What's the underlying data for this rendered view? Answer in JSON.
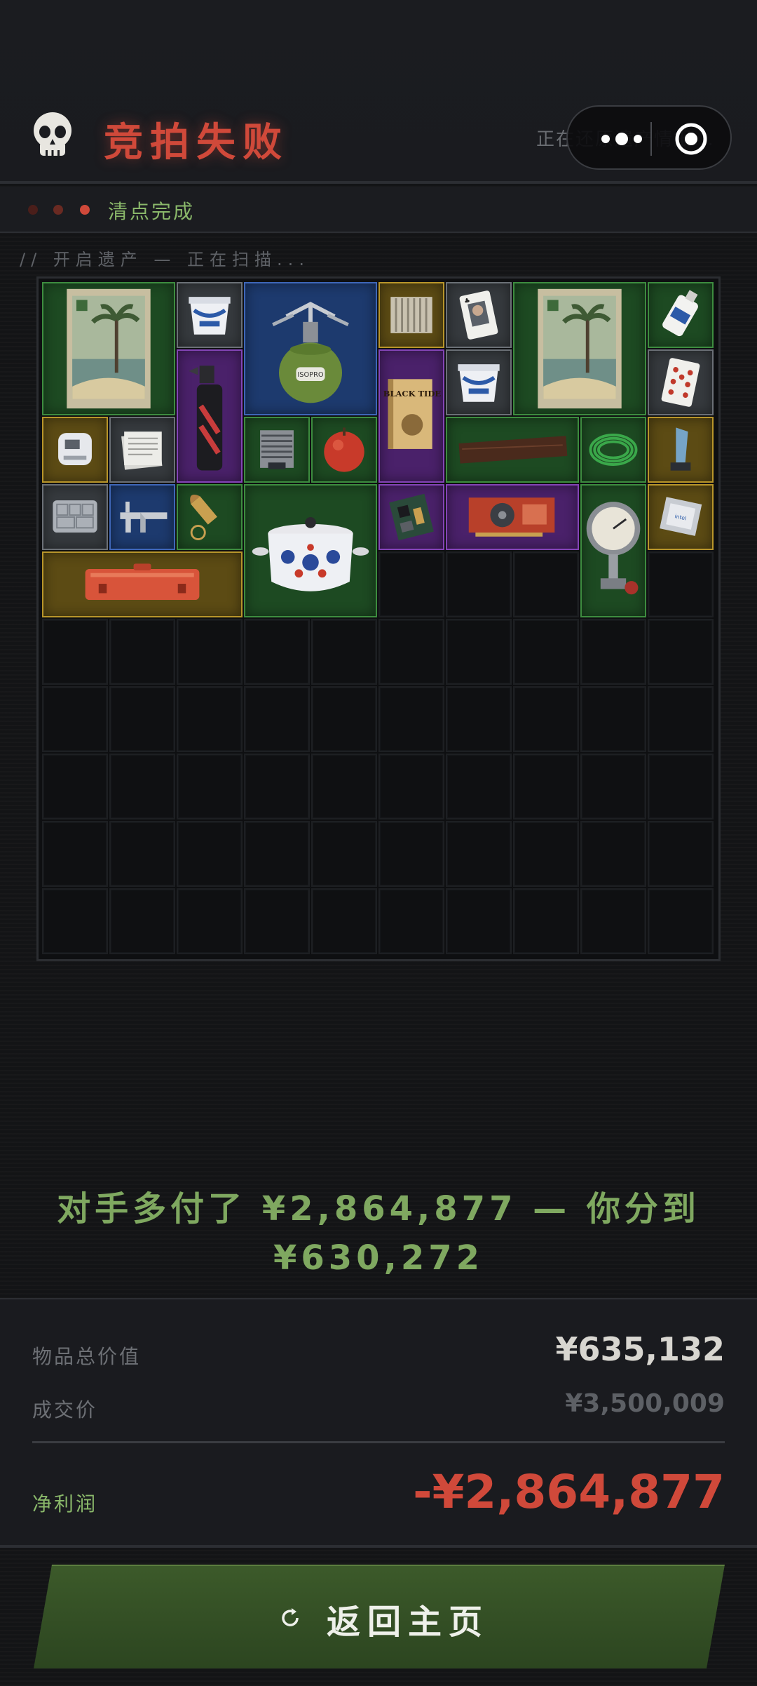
{
  "header": {
    "title": "竞拍失败",
    "status_text": "正在还原遗产情报...",
    "skull_icon": "skull-icon",
    "title_color": "#d0493a"
  },
  "capsule": {
    "more_icon": "more-dots-icon",
    "close_icon": "target-close-icon"
  },
  "subbar": {
    "label": "清点完成"
  },
  "scan": {
    "text": "// 开启遗产 — 正在扫描..."
  },
  "grid": {
    "columns": 10,
    "rows": 10,
    "items": [
      {
        "name": "beach-poster",
        "rarity": "green"
      },
      {
        "name": "yogurt-cup",
        "rarity": "gray"
      },
      {
        "name": "camping-stove",
        "rarity": "blue"
      },
      {
        "name": "heatsink-block",
        "rarity": "gold"
      },
      {
        "name": "playing-card-jack",
        "rarity": "gray"
      },
      {
        "name": "beach-poster",
        "rarity": "green"
      },
      {
        "name": "sos-glue-tube",
        "rarity": "green"
      },
      {
        "name": "blow-torch",
        "rarity": "purple"
      },
      {
        "name": "black-tide-book",
        "rarity": "purple"
      },
      {
        "name": "yogurt-cup",
        "rarity": "gray"
      },
      {
        "name": "playing-card-hearts",
        "rarity": "gray"
      },
      {
        "name": "medical-device",
        "rarity": "gold"
      },
      {
        "name": "document-stack",
        "rarity": "gray"
      },
      {
        "name": "cpu-cooler",
        "rarity": "green"
      },
      {
        "name": "apple",
        "rarity": "green"
      },
      {
        "name": "wooden-plank",
        "rarity": "green"
      },
      {
        "name": "green-hose-coil",
        "rarity": "green"
      },
      {
        "name": "crystal-trophy",
        "rarity": "gold"
      },
      {
        "name": "plastic-organizer",
        "rarity": "gray"
      },
      {
        "name": "caliper",
        "rarity": "blue"
      },
      {
        "name": "bullet-keychain",
        "rarity": "green"
      },
      {
        "name": "enamel-pot",
        "rarity": "green"
      },
      {
        "name": "circuit-board",
        "rarity": "purple"
      },
      {
        "name": "graphics-card",
        "rarity": "purple"
      },
      {
        "name": "pressure-gauge",
        "rarity": "green"
      },
      {
        "name": "cpu-chip",
        "rarity": "gold"
      },
      {
        "name": "orange-hard-case",
        "rarity": "gold"
      }
    ]
  },
  "message": {
    "line1": "对手多付了 ¥2,864,877 — 你分到",
    "line2": "¥630,272"
  },
  "summary": {
    "total_label": "物品总价值",
    "total_value": "¥635,132",
    "deal_label": "成交价",
    "deal_value": "¥3,500,009",
    "profit_label": "净利润",
    "profit_value": "-¥2,864,877"
  },
  "button": {
    "label": "返回主页",
    "icon": "refresh-icon"
  }
}
